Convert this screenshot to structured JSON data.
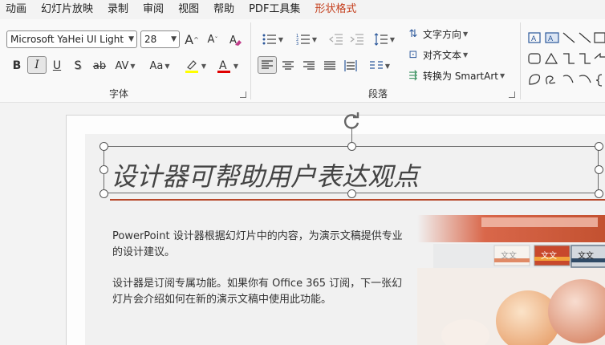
{
  "tabs": [
    "动画",
    "幻灯片放映",
    "录制",
    "审阅",
    "视图",
    "帮助",
    "PDF工具集",
    "形状格式"
  ],
  "active_tab_index": 7,
  "font_group": {
    "label": "字体",
    "font_name": "Microsoft YaHei UI Light",
    "font_size": "28",
    "grow_glyph": "A",
    "shrink_glyph": "A",
    "bold": "B",
    "italic": "I",
    "underline": "U",
    "shadow": "S",
    "strike": "ab",
    "spacing": "AV",
    "case": "Aa",
    "font_color_glyph": "A"
  },
  "paragraph_group": {
    "label": "段落",
    "text_direction": "文字方向",
    "align_text": "对齐文本",
    "convert_smartart": "转换为 SmartArt"
  },
  "slide": {
    "title": "设计器可帮助用户表达观点",
    "para1": "PowerPoint 设计器根据幻灯片中的内容，为演示文稿提供专业的设计建议。",
    "para2": "设计器是订阅专属功能。如果你有 Office 365 订阅，下一张幻灯片会介绍如何在新的演示文稿中使用此功能。",
    "thumb_label": "文文",
    "thumb_label2": "文文",
    "thumb_label3": "文文"
  },
  "colors": {
    "accent": "#c43e1c",
    "highlight": "#ffff00",
    "font_color": "#e00000",
    "title_line": "#b7472a"
  }
}
